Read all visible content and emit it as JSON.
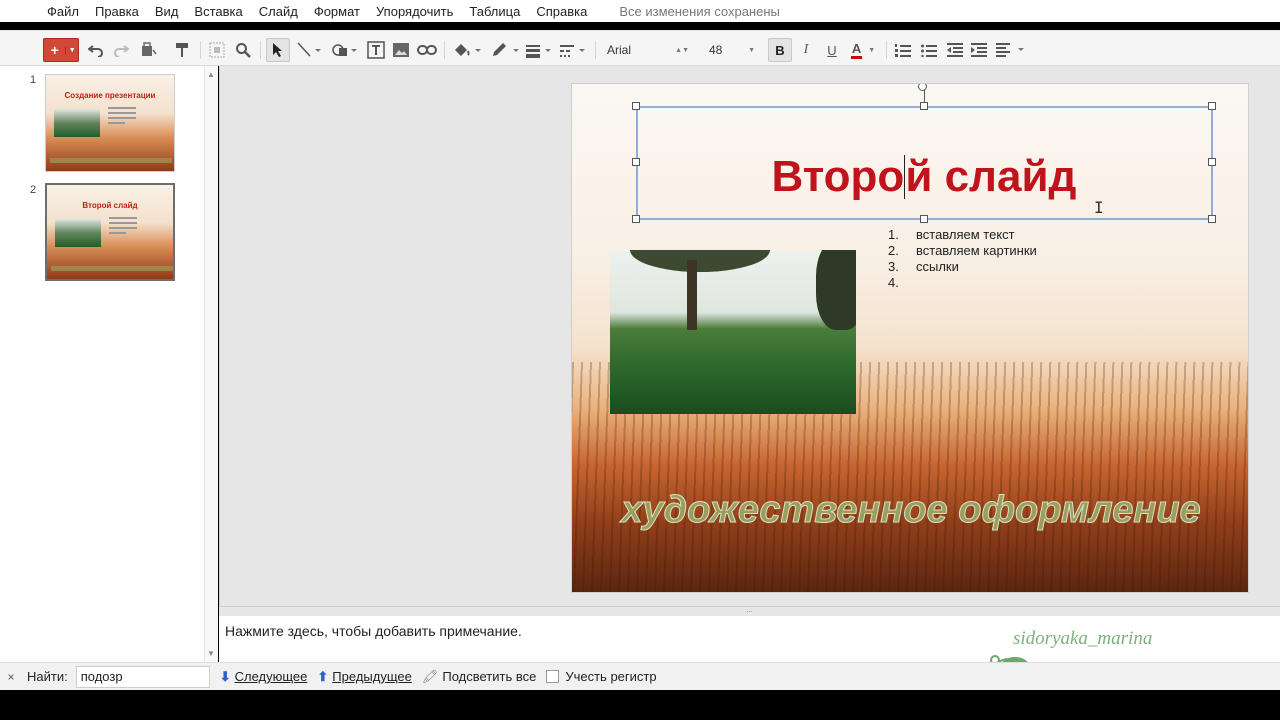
{
  "menu": {
    "items": [
      "Файл",
      "Правка",
      "Вид",
      "Вставка",
      "Слайд",
      "Формат",
      "Упорядочить",
      "Таблица",
      "Справка"
    ],
    "save_status": "Все изменения сохранены"
  },
  "toolbar": {
    "new_label": "+",
    "font": "Arial",
    "font_size": "48",
    "bold": "B",
    "italic": "I",
    "underline": "U",
    "text_color": "A",
    "text_color_value": "#cc0000",
    "icons": [
      "undo-icon",
      "redo-icon",
      "paint-bucket-icon",
      "paint-format-icon",
      "zoom-fit-icon",
      "zoom-icon",
      "select-icon",
      "line-icon",
      "shape-icon",
      "textbox-icon",
      "image-icon",
      "link-icon",
      "fill-color-icon",
      "border-color-icon",
      "border-weight-icon",
      "border-dash-icon",
      "numbered-list-icon",
      "bulleted-list-icon",
      "decrease-indent-icon",
      "increase-indent-icon",
      "align-icon"
    ]
  },
  "slides_panel": {
    "thumbs": [
      {
        "number": "1",
        "title": "Создание презентации"
      },
      {
        "number": "2",
        "title": "Второй слайд"
      }
    ]
  },
  "slide": {
    "title_before_caret": "Второ",
    "title_after_caret": "й слайд",
    "list": [
      {
        "n": "1.",
        "text": "вставляем текст"
      },
      {
        "n": "2.",
        "text": "вставляем картинки"
      },
      {
        "n": "3.",
        "text": "ссылки"
      },
      {
        "n": "4.",
        "text": ""
      }
    ],
    "wordart": "художественное оформление"
  },
  "notes": {
    "placeholder": "Нажмите здесь, чтобы добавить примечание."
  },
  "watermark": {
    "text": "sidoryaka_marina"
  },
  "findbar": {
    "close": "×",
    "label": "Найти:",
    "value": "подозр",
    "next": "Следующее",
    "prev": "Предыдущее",
    "highlight_all": "Подсветить все",
    "match_case": "Учесть регистр"
  },
  "colors": {
    "title_red": "#c1131b",
    "new_button": "#d14836",
    "selection_blue": "#8fadd6"
  }
}
